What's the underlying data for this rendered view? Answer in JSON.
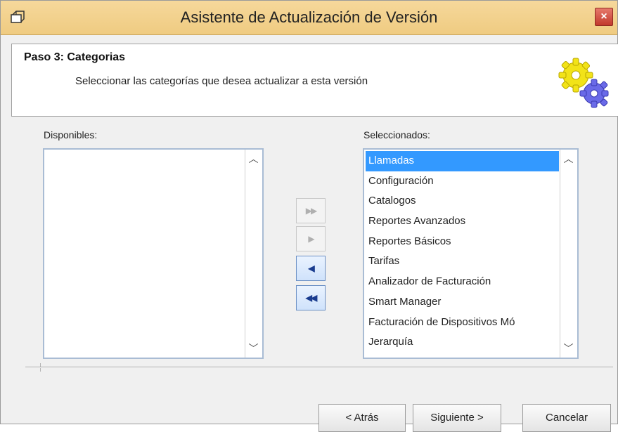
{
  "window": {
    "title": "Asistente de Actualización de Versión",
    "close_glyph": "×"
  },
  "header": {
    "step_title": "Paso 3: Categorias",
    "description": "Seleccionar las categorías que desea actualizar a esta versión",
    "icon": "gears-icon"
  },
  "available": {
    "label": "Disponibles:",
    "items": []
  },
  "selected": {
    "label": "Seleccionados:",
    "items": [
      "Llamadas",
      "Configuración",
      "Catalogos",
      "Reportes Avanzados",
      "Reportes Básicos",
      "Tarifas",
      "Analizador de Facturación",
      "Smart Manager",
      "Facturación de Dispositivos Mó",
      "Jerarquía"
    ],
    "highlighted_index": 0
  },
  "transfer": {
    "add_all_glyph": "▶▶",
    "add_glyph": "▶",
    "remove_glyph": "◀",
    "remove_all_glyph": "◀◀",
    "enabled": {
      "add_all": false,
      "add": false,
      "remove": true,
      "remove_all": true
    }
  },
  "footer": {
    "back_label": "< Atrás",
    "next_label": "Siguiente >",
    "cancel_label": "Cancelar"
  },
  "colors": {
    "titlebar": "#efcb81",
    "selection": "#3399ff",
    "listbox_border": "#a9bcd4"
  }
}
